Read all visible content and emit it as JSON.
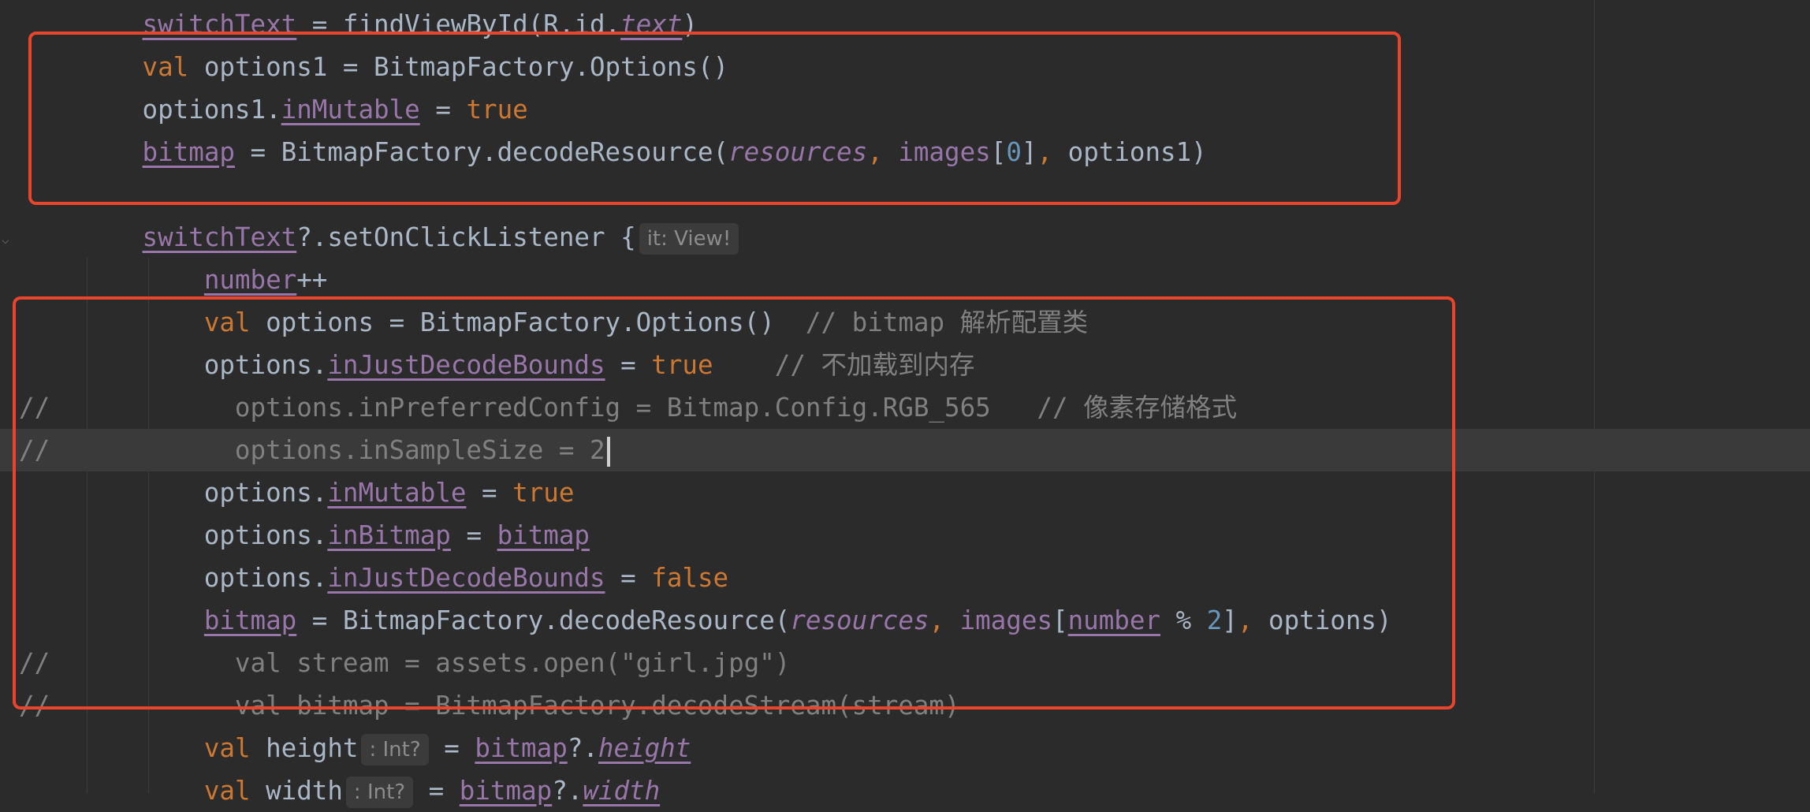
{
  "editor": {
    "lines": [
      {
        "marker": "",
        "tokens": [
          {
            "t": "        ",
            "c": ""
          },
          {
            "t": "switchText",
            "c": "prop"
          },
          {
            "t": " = findViewById(R.id.",
            "c": "fn"
          },
          {
            "t": "text",
            "c": "propi"
          },
          {
            "t": ")",
            "c": "fn"
          }
        ]
      },
      {
        "marker": "",
        "tokens": [
          {
            "t": "        ",
            "c": ""
          },
          {
            "t": "val",
            "c": "kw"
          },
          {
            "t": " options1 = BitmapFactory.Options()",
            "c": "fn"
          }
        ]
      },
      {
        "marker": "",
        "tokens": [
          {
            "t": "        options1.",
            "c": "fn"
          },
          {
            "t": "inMutable",
            "c": "prop"
          },
          {
            "t": " = ",
            "c": "fn"
          },
          {
            "t": "true",
            "c": "kw"
          }
        ]
      },
      {
        "marker": "",
        "tokens": [
          {
            "t": "        ",
            "c": ""
          },
          {
            "t": "bitmap",
            "c": "prop"
          },
          {
            "t": " = BitmapFactory.decodeResource(",
            "c": "fn"
          },
          {
            "t": "resources",
            "c": "italic-prop"
          },
          {
            "t": ", ",
            "c": "kw"
          },
          {
            "t": "images",
            "c": "italic-prop-noit"
          },
          {
            "t": "[",
            "c": "fn"
          },
          {
            "t": "0",
            "c": "num"
          },
          {
            "t": "]",
            "c": "fn"
          },
          {
            "t": ", ",
            "c": "kw"
          },
          {
            "t": "options1)",
            "c": "fn"
          }
        ]
      },
      {
        "marker": "",
        "tokens": []
      },
      {
        "marker": "",
        "tokens": [
          {
            "t": "        ",
            "c": ""
          },
          {
            "t": "switchText",
            "c": "prop"
          },
          {
            "t": "?.setOnClickListener {",
            "c": "fn"
          },
          {
            "t": "it: View!",
            "c": "hint"
          }
        ]
      },
      {
        "marker": "",
        "tokens": [
          {
            "t": "            ",
            "c": ""
          },
          {
            "t": "number",
            "c": "prop"
          },
          {
            "t": "++",
            "c": "fn"
          }
        ]
      },
      {
        "marker": "",
        "tokens": [
          {
            "t": "            ",
            "c": ""
          },
          {
            "t": "val",
            "c": "kw"
          },
          {
            "t": " options = BitmapFactory.Options()  ",
            "c": "fn"
          },
          {
            "t": "// bitmap 解析配置类",
            "c": "cmt"
          }
        ]
      },
      {
        "marker": "",
        "tokens": [
          {
            "t": "            options.",
            "c": "fn"
          },
          {
            "t": "inJustDecodeBounds",
            "c": "prop"
          },
          {
            "t": " = ",
            "c": "fn"
          },
          {
            "t": "true",
            "c": "kw"
          },
          {
            "t": "    // 不加载到内存",
            "c": "cmt"
          }
        ]
      },
      {
        "marker": "//",
        "tokens": [
          {
            "t": "              options.inPreferredConfig = Bitmap.Config.RGB_565   // 像素存储格式",
            "c": "dim"
          }
        ]
      },
      {
        "marker": "//",
        "current": true,
        "tokens": [
          {
            "t": "              options.inSampleSize = 2",
            "c": "dim"
          },
          {
            "t": "",
            "c": "caret"
          }
        ]
      },
      {
        "marker": "",
        "tokens": [
          {
            "t": "            options.",
            "c": "fn"
          },
          {
            "t": "inMutable",
            "c": "prop"
          },
          {
            "t": " = ",
            "c": "fn"
          },
          {
            "t": "true",
            "c": "kw"
          }
        ]
      },
      {
        "marker": "",
        "tokens": [
          {
            "t": "            options.",
            "c": "fn"
          },
          {
            "t": "inBitmap",
            "c": "prop"
          },
          {
            "t": " = ",
            "c": "fn"
          },
          {
            "t": "bitmap",
            "c": "prop"
          }
        ]
      },
      {
        "marker": "",
        "tokens": [
          {
            "t": "            options.",
            "c": "fn"
          },
          {
            "t": "inJustDecodeBounds",
            "c": "prop"
          },
          {
            "t": " = ",
            "c": "fn"
          },
          {
            "t": "false",
            "c": "kw"
          }
        ]
      },
      {
        "marker": "",
        "tokens": [
          {
            "t": "            ",
            "c": ""
          },
          {
            "t": "bitmap",
            "c": "prop"
          },
          {
            "t": " = BitmapFactory.decodeResource(",
            "c": "fn"
          },
          {
            "t": "resources",
            "c": "italic-prop"
          },
          {
            "t": ", ",
            "c": "kw"
          },
          {
            "t": "images",
            "c": "italic-prop-noit"
          },
          {
            "t": "[",
            "c": "fn"
          },
          {
            "t": "number",
            "c": "prop"
          },
          {
            "t": " % ",
            "c": "fn"
          },
          {
            "t": "2",
            "c": "num"
          },
          {
            "t": "]",
            "c": "fn"
          },
          {
            "t": ", ",
            "c": "kw"
          },
          {
            "t": "options)",
            "c": "fn"
          }
        ]
      },
      {
        "marker": "//",
        "tokens": [
          {
            "t": "              val stream = assets.open(\"girl.jpg\")",
            "c": "dim"
          }
        ]
      },
      {
        "marker": "//",
        "tokens": [
          {
            "t": "              val bitmap = BitmapFactory.decodeStream(stream)",
            "c": "dim"
          }
        ]
      },
      {
        "marker": "",
        "tokens": [
          {
            "t": "            ",
            "c": ""
          },
          {
            "t": "val",
            "c": "kw"
          },
          {
            "t": " height",
            "c": "fn"
          },
          {
            "t": ": Int?",
            "c": "hint"
          },
          {
            "t": " = ",
            "c": "fn"
          },
          {
            "t": "bitmap",
            "c": "prop"
          },
          {
            "t": "?.",
            "c": "fn"
          },
          {
            "t": "height",
            "c": "propi"
          }
        ]
      },
      {
        "marker": "",
        "tokens": [
          {
            "t": "            ",
            "c": ""
          },
          {
            "t": "val",
            "c": "kw"
          },
          {
            "t": " width",
            "c": "fn"
          },
          {
            "t": ": Int?",
            "c": "hint"
          },
          {
            "t": " = ",
            "c": "fn"
          },
          {
            "t": "bitmap",
            "c": "prop"
          },
          {
            "t": "?.",
            "c": "fn"
          },
          {
            "t": "width",
            "c": "propi"
          }
        ]
      }
    ]
  },
  "colors": {
    "background": "#2b2b2b",
    "highlight_box": "#e8452c",
    "keyword": "#cc7832",
    "property": "#9876aa",
    "number": "#6897bb",
    "comment": "#808080",
    "plain": "#a9b7c6"
  }
}
